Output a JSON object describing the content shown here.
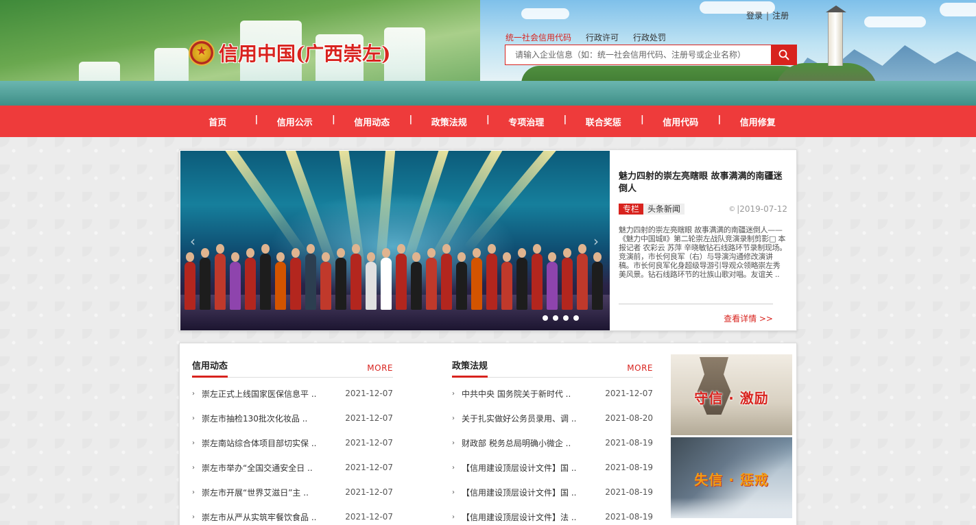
{
  "header": {
    "site_title": "信用中国(广西崇左)",
    "login": "登录",
    "register": "注册",
    "login_separator": "|",
    "search_tabs": [
      "统一社会信用代码",
      "行政许可",
      "行政处罚"
    ],
    "search_placeholder": "请输入企业信息（如：统一社会信用代码、注册号或企业名称）"
  },
  "nav": {
    "items": [
      "首页",
      "信用公示",
      "信用动态",
      "政策法规",
      "专项治理",
      "联合奖惩",
      "信用代码",
      "信用修复"
    ]
  },
  "feature": {
    "title": "魅力四射的崇左亮瞎眼 故事满满的南疆迷倒人",
    "badge": "专栏",
    "tag": "头条新闻",
    "date_icon": "©",
    "date": "|2019-07-12",
    "summary": "魅力四射的崇左亮瞎眼 故事满满的南疆迷倒人——《魅力中国城Ⅱ》第二轮崇左战队竞演录制剪影□ 本报记者 农彩云 苏萍 辛晓敏钻石线路环节录制现场。竞演前，市长何良军（右）与导演沟通修改演讲稿。市长何良军化身超级导游引导观众领略崇左秀美风景。钻石线路环节的壮族山歌对唱。友谊关 ..",
    "more": "查看详情 >>",
    "slide_count": 4,
    "active_slide": 1
  },
  "credit_news": {
    "title": "信用动态",
    "more": "MORE",
    "items": [
      {
        "title": "崇左正式上线国家医保信息平 ..",
        "date": "2021-12-07"
      },
      {
        "title": "崇左市抽检130批次化妆品 ..",
        "date": "2021-12-07"
      },
      {
        "title": "崇左南站综合体项目部切实保 ..",
        "date": "2021-12-07"
      },
      {
        "title": "崇左市举办“全国交通安全日 ..",
        "date": "2021-12-07"
      },
      {
        "title": "崇左市开展“世界艾滋日”主 ..",
        "date": "2021-12-07"
      },
      {
        "title": "崇左市从严从实筑牢餐饮食品 ..",
        "date": "2021-12-07"
      }
    ]
  },
  "policy": {
    "title": "政策法规",
    "more": "MORE",
    "items": [
      {
        "title": "中共中央 国务院关于新时代 ..",
        "date": "2021-12-07"
      },
      {
        "title": "关于扎实做好公务员录用、调 ..",
        "date": "2021-08-20"
      },
      {
        "title": "财政部 税务总局明确小微企 ..",
        "date": "2021-08-19"
      },
      {
        "title": "【信用建设顶层设计文件】国 ..",
        "date": "2021-08-19"
      },
      {
        "title": "【信用建设顶层设计文件】国 ..",
        "date": "2021-08-19"
      },
      {
        "title": "【信用建设顶层设计文件】法 ..",
        "date": "2021-08-19"
      }
    ]
  },
  "promos": {
    "trust": "守信 · 激励",
    "distrust": "失信 · 惩戒"
  },
  "colors": {
    "brand_red": "#d8231e",
    "nav_red": "#ee3b3b"
  }
}
